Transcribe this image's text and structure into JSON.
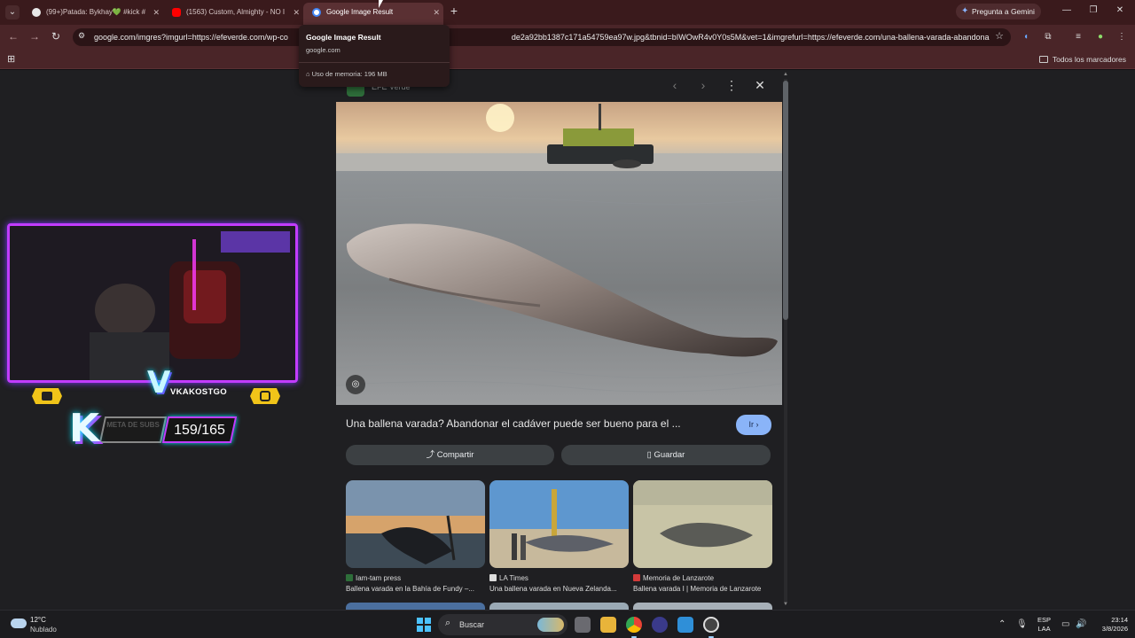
{
  "browser": {
    "tabs": [
      {
        "label": "(99+)Patada: Bykhay💚 #kick #",
        "favicon_color": "#e8e8e8",
        "active": false
      },
      {
        "label": "(1563) Custom, Almighty - NO I",
        "favicon_color": "#ff0000",
        "active": false
      },
      {
        "label": "Google Image Result",
        "favicon_color": "#ffffff",
        "active": true
      }
    ],
    "gemini_label": "Pregunta a Gemini",
    "url": "google.com/imgres?imgurl=https://efeverde.com/wp-content/uploads/2024/...de2a92bb1387c171a54759ea97w.jpg&tbnid=bIWOwR4v0Y0s5M&vet=1&imgrefurl=https://efeverde.com/una-ballena-varada-abandonar-el-cad...",
    "url_shown_left": "google.com/imgres?imgurl=https://efeverde.com/wp-co",
    "url_shown_right": "de2a92bb1387c171a54759ea97w.jpg&tbnid=bIWOwR4v0Y0s5M&vet=1&imgrefurl=https://efeverde.com/una-ballena-varada-abandonar-el-cad...",
    "bookmarks_all_label": "Todos los marcadores"
  },
  "hovercard": {
    "title": "Google Image Result",
    "domain": "google.com",
    "memory": "Uso de memoria: 196 MB"
  },
  "viewer": {
    "source_name": "EFE Verde",
    "caption": "Una ballena varada? Abandonar el cadáver puede ser bueno para el ...",
    "go_label": "Ir",
    "share_label": "Compartir",
    "save_label": "Guardar",
    "related": [
      {
        "source": "Iam-tam press",
        "title": "Ballena varada en la Bahía de Fundy –...",
        "icon_color": "#2e6e3a"
      },
      {
        "source": "LA Times",
        "title": "Una ballena varada en Nueva Zelanda...",
        "icon_color": "#dddddd"
      },
      {
        "source": "Memoria de Lanzarote",
        "title": "Ballena varada I | Memoria de Lanzarote",
        "icon_color": "#d33a3a"
      }
    ]
  },
  "overlay": {
    "channel_name": "VKAKOSTGO",
    "goal_label": "META DE SUBS",
    "sub_count": "159/165"
  },
  "taskbar": {
    "temperature": "12°C",
    "weather": "Nublado",
    "search_label": "Buscar",
    "lang_top": "ESP",
    "lang_bottom": "LAA",
    "time": "23:14",
    "date": "3/8/2026"
  },
  "colors": {
    "tabbar": "#3a1a1c",
    "toolbar": "#4a2528",
    "accent_button": "#8ab4f8",
    "overlay_neon_purple": "#c23cff",
    "overlay_neon_cyan": "#00e5ff",
    "overlay_yellow": "#f0c419"
  }
}
